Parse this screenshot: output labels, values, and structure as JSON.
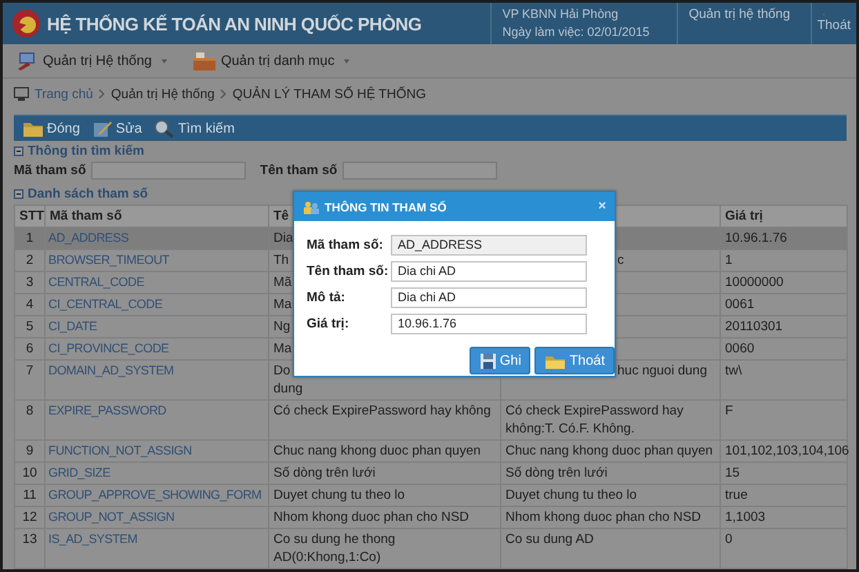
{
  "header": {
    "title": "HỆ THỐNG KẾ TOÁN AN NINH QUỐC PHÒNG",
    "office": "VP KBNN Hải Phòng",
    "work_date": "Ngày làm việc: 02/01/2015",
    "admin_link": "Quản trị hệ thống",
    "logout": "Thoát"
  },
  "menu": [
    {
      "label": "Quản trị Hệ thống",
      "kind": "admin"
    },
    {
      "label": "Quản trị danh mục",
      "kind": "catalog"
    }
  ],
  "breadcrumb": [
    "Trang chủ",
    "Quản trị Hệ thống",
    "QUẢN LÝ THAM SỐ HỆ THỐNG"
  ],
  "toolbar": [
    {
      "label": "Đóng",
      "kind": "close"
    },
    {
      "label": "Sửa",
      "kind": "edit"
    },
    {
      "label": "Tìm kiếm",
      "kind": "search"
    }
  ],
  "search": {
    "title": "Thông tin tìm kiếm",
    "fields": [
      {
        "label": "Mã tham số"
      },
      {
        "label": "Tên tham số"
      }
    ]
  },
  "table": {
    "title": "Danh sách tham số",
    "columns": {
      "stt": "STT",
      "code": "Mã tham số",
      "name": "Tê",
      "value": "Giá trị"
    },
    "rows": [
      {
        "stt": "1",
        "code": "AD_ADDRESS",
        "name": "Dia",
        "value": "10.96.1.76",
        "selected": true
      },
      {
        "stt": "2",
        "code": "BROWSER_TIMEOUT",
        "name": "Th",
        "description_tail": "c",
        "value": "1",
        "selected": false
      },
      {
        "stt": "3",
        "code": "CENTRAL_CODE",
        "name": "Mã",
        "value": "10000000",
        "selected": false
      },
      {
        "stt": "4",
        "code": "CI_CENTRAL_CODE",
        "name": "Ma",
        "value": "0061",
        "selected": false
      },
      {
        "stt": "5",
        "code": "CI_DATE",
        "name": "Ng",
        "value": "20110301",
        "selected": false
      },
      {
        "stt": "6",
        "code": "CI_PROVINCE_CODE",
        "name": "Ma",
        "value": "0060",
        "selected": false
      },
      {
        "stt": "7",
        "code": "DOMAIN_AD_SYSTEM",
        "name": "Do",
        "name_line_2": "dung",
        "description_tail": "huc nguoi dung",
        "value": "tw\\",
        "selected": false
      },
      {
        "stt": "8",
        "code": "EXPIRE_PASSWORD",
        "name": "Có check ExpirePassword hay không",
        "description": "Có check ExpirePassword hay không:T. Có.F. Không.",
        "value": "F",
        "selected": false
      },
      {
        "stt": "9",
        "code": "FUNCTION_NOT_ASSIGN",
        "name": "Chuc nang khong duoc phan quyen",
        "description": "Chuc nang khong duoc phan quyen",
        "value": "101,102,103,104,106",
        "selected": false
      },
      {
        "stt": "10",
        "code": "GRID_SIZE",
        "name": "Số dòng trên lưới",
        "description": "Số dòng trên lưới",
        "value": "15",
        "selected": false
      },
      {
        "stt": "11",
        "code": "GROUP_APPROVE_SHOWING_FORM",
        "name": "Duyet chung tu theo lo",
        "description": "Duyet chung tu theo lo",
        "value": "true",
        "selected": false
      },
      {
        "stt": "12",
        "code": "GROUP_NOT_ASSIGN",
        "name": "Nhom khong duoc phan cho NSD",
        "description": "Nhom khong duoc phan cho NSD",
        "value": "1,1003",
        "selected": false
      },
      {
        "stt": "13",
        "code": "IS_AD_SYSTEM",
        "name": "Co su dung he thong AD(0:Khong,1:Co)",
        "description": "Co su dung AD",
        "value": "0",
        "selected": false
      }
    ]
  },
  "dialog": {
    "title": "THÔNG TIN THAM SỐ",
    "close": "×",
    "fields": [
      {
        "label": "Mã tham số:",
        "value": "AD_ADDRESS",
        "disabled": true
      },
      {
        "label": "Tên tham số:",
        "value": "Dia chi AD",
        "disabled": false
      },
      {
        "label": "Mô tả:",
        "value": "Dia chi AD",
        "disabled": false
      },
      {
        "label": "Giá trị:",
        "value": "10.96.1.76",
        "disabled": false
      }
    ],
    "buttons": [
      {
        "label": "Ghi",
        "kind": "save"
      },
      {
        "label": "Thoát",
        "kind": "exit"
      }
    ]
  }
}
